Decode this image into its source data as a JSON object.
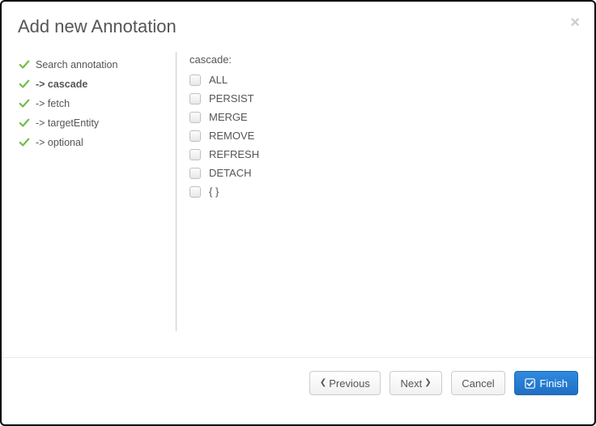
{
  "dialog": {
    "title": "Add new Annotation"
  },
  "wizard": {
    "steps": [
      {
        "label": "Search annotation",
        "active": false
      },
      {
        "label": "-> cascade",
        "active": true
      },
      {
        "label": "-> fetch",
        "active": false
      },
      {
        "label": "-> targetEntity",
        "active": false
      },
      {
        "label": "-> optional",
        "active": false
      }
    ]
  },
  "content": {
    "field_label": "cascade:",
    "options": [
      {
        "label": "ALL",
        "checked": false
      },
      {
        "label": "PERSIST",
        "checked": false
      },
      {
        "label": "MERGE",
        "checked": false
      },
      {
        "label": "REMOVE",
        "checked": false
      },
      {
        "label": "REFRESH",
        "checked": false
      },
      {
        "label": "DETACH",
        "checked": false
      },
      {
        "label": "{ }",
        "checked": false
      }
    ]
  },
  "footer": {
    "previous_label": "Previous",
    "next_label": "Next",
    "cancel_label": "Cancel",
    "finish_label": "Finish"
  },
  "colors": {
    "primary": "#2f8ae0",
    "check": "#6fbf44"
  }
}
